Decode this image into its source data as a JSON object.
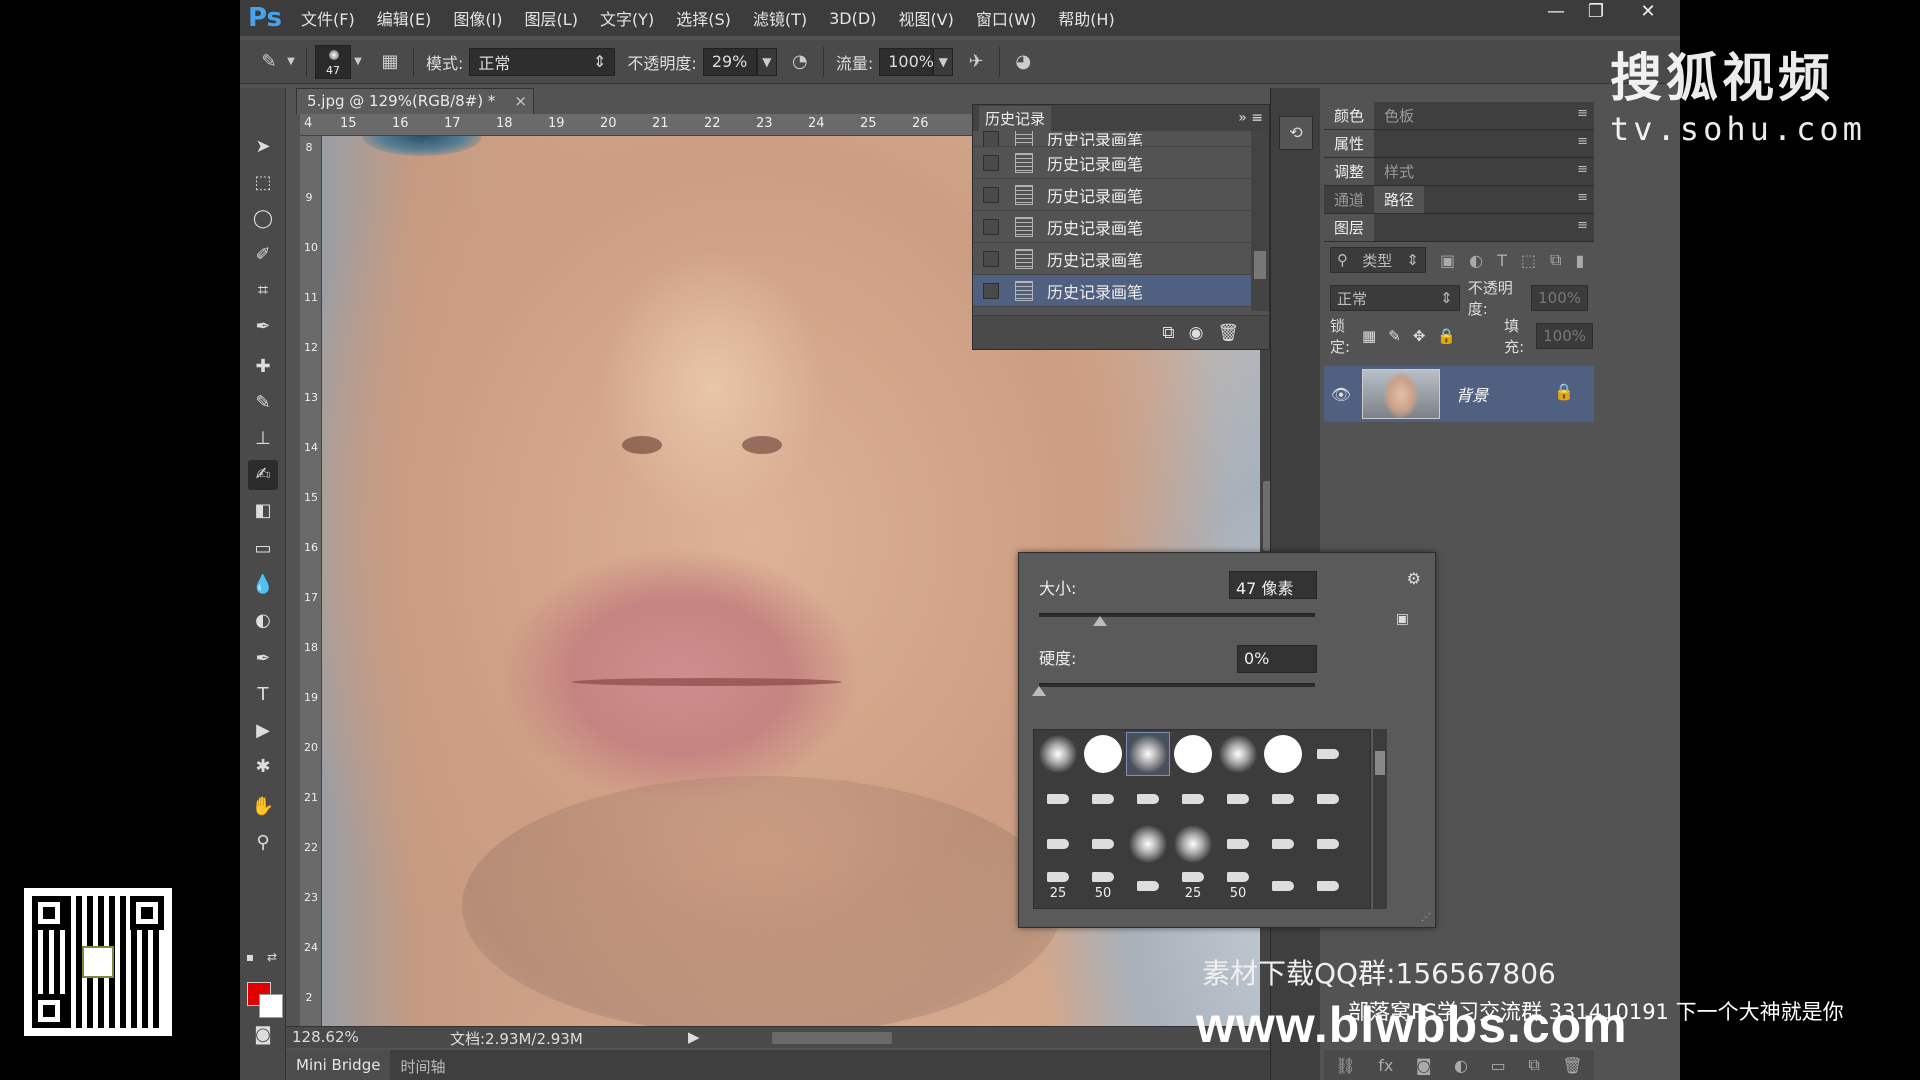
{
  "app": {
    "logo": "Ps",
    "menu": [
      "文件(F)",
      "编辑(E)",
      "图像(I)",
      "图层(L)",
      "文字(Y)",
      "选择(S)",
      "滤镜(T)",
      "3D(D)",
      "视图(V)",
      "窗口(W)",
      "帮助(H)"
    ],
    "window_controls": [
      "—",
      "❐",
      "✕"
    ]
  },
  "options_bar": {
    "brush_size": "47",
    "mode_label": "模式:",
    "mode_value": "正常",
    "opacity_label": "不透明度:",
    "opacity_value": "29%",
    "flow_label": "流量:",
    "flow_value": "100%"
  },
  "document": {
    "tab_title": "5.jpg @ 129%(RGB/8#) *",
    "tab_close": "×",
    "ruler_top": [
      "4",
      "15",
      "16",
      "17",
      "18",
      "19",
      "20",
      "21",
      "22",
      "23",
      "24",
      "25",
      "26"
    ],
    "ruler_left": [
      "8",
      "9",
      "10",
      "11",
      "12",
      "13",
      "14",
      "15",
      "16",
      "17",
      "18",
      "19",
      "20",
      "21",
      "22",
      "23",
      "24",
      "2"
    ],
    "zoom": "128.62%",
    "doc_info": "文档:2.93M/2.93M",
    "bottom_tabs": [
      "Mini Bridge",
      "时间轴"
    ]
  },
  "history": {
    "title": "历史记录",
    "items": [
      {
        "label": "历史记录画笔",
        "selected": false
      },
      {
        "label": "历史记录画笔",
        "selected": false
      },
      {
        "label": "历史记录画笔",
        "selected": false
      },
      {
        "label": "历史记录画笔",
        "selected": false
      },
      {
        "label": "历史记录画笔",
        "selected": false
      },
      {
        "label": "历史记录画笔",
        "selected": true
      }
    ]
  },
  "panels": {
    "tab_row1": [
      "颜色",
      "色板"
    ],
    "tab_row2": [
      "属性"
    ],
    "tab_row3": [
      "调整",
      "样式"
    ],
    "tab_row4": [
      "通道",
      "路径"
    ],
    "tab_row5": [
      "图层"
    ],
    "layer_filter": "类型",
    "blend_mode": "正常",
    "opacity_label": "不透明度:",
    "opacity_value": "100%",
    "lock_label": "锁定:",
    "fill_label": "填充:",
    "fill_value": "100%",
    "layer_name": "背景"
  },
  "brush_popup": {
    "size_label": "大小:",
    "size_value": "47 像素",
    "hardness_label": "硬度:",
    "hardness_value": "0%",
    "size_fraction": 0.22,
    "hardness_fraction": 0.0,
    "preset_labels": [
      "25",
      "50",
      "25",
      "50"
    ]
  },
  "overlays": {
    "sohu_logo": "搜狐视频",
    "sohu_url": "tv.sohu.com",
    "qq_group": "素材下载QQ群:156567806",
    "site": "www.blwbbs.com",
    "group_text": "部落窝PS学习交流群 331410191 下一个大神就是你"
  },
  "colors": {
    "foreground": "#e00000",
    "background": "#ffffff",
    "selection": "#506080"
  }
}
